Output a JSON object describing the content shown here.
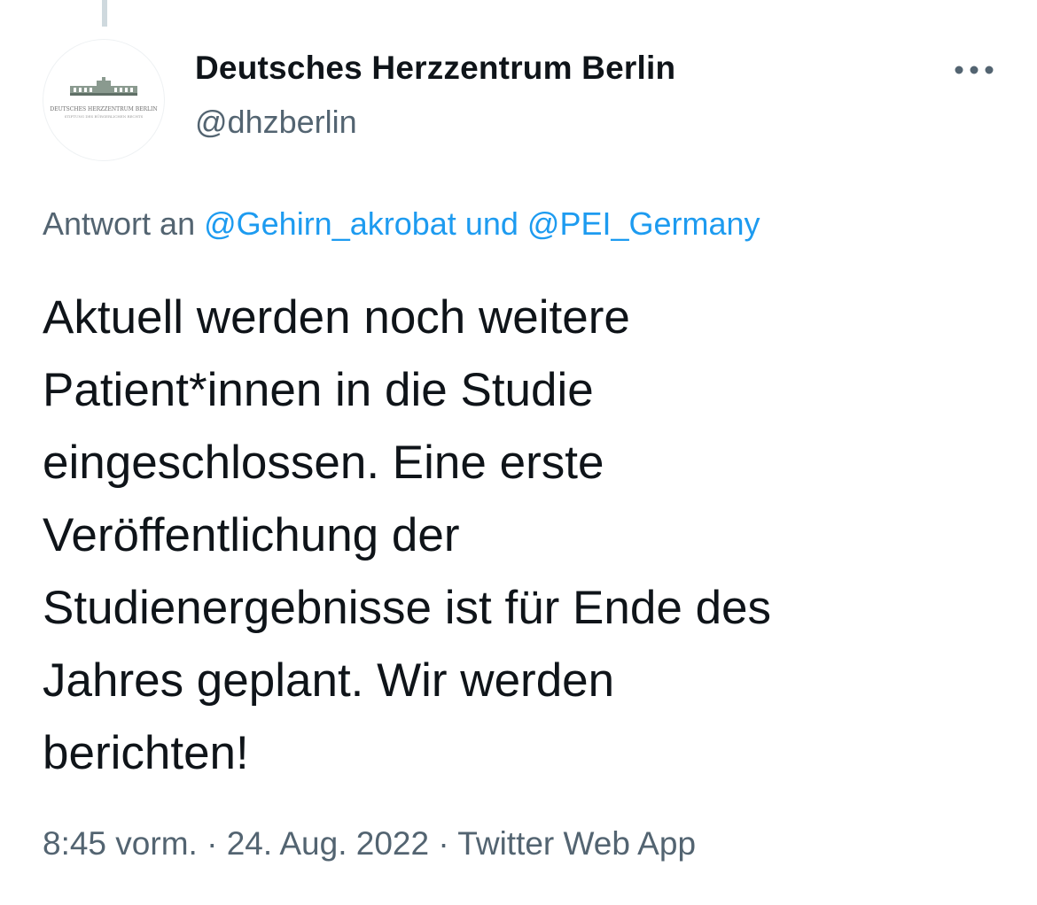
{
  "tweet": {
    "author": {
      "display_name": "Deutsches Herzzentrum Berlin",
      "handle": "@dhzberlin",
      "avatar_icon": "dhz-building-logo-icon",
      "avatar_logo_text": "DEUTSCHES HERZZENTRUM BERLIN",
      "avatar_logo_subtext": "STIFTUNG DES BÜRGERLICHEN RECHTS"
    },
    "more_icon": "more-dots-icon",
    "reply": {
      "prefix": "Antwort an",
      "mention_1": "@Gehirn_akrobat",
      "joiner": "und",
      "mention_2": "@PEI_Germany"
    },
    "text": "Aktuell werden noch weitere\nPatient*innen in die Studie\neingeschlossen. Eine erste\nVeröffentlichung der\nStudienergebnisse ist für Ende des\nJahres geplant. Wir werden\nberichten!",
    "meta": {
      "time": "8:45 vorm.",
      "separator": " · ",
      "date": "24. Aug. 2022",
      "source": "Twitter Web App"
    }
  },
  "colors": {
    "text_primary": "#0f1419",
    "text_secondary": "#536471",
    "link": "#1d9bf0",
    "thread_line": "#cfd9de"
  }
}
